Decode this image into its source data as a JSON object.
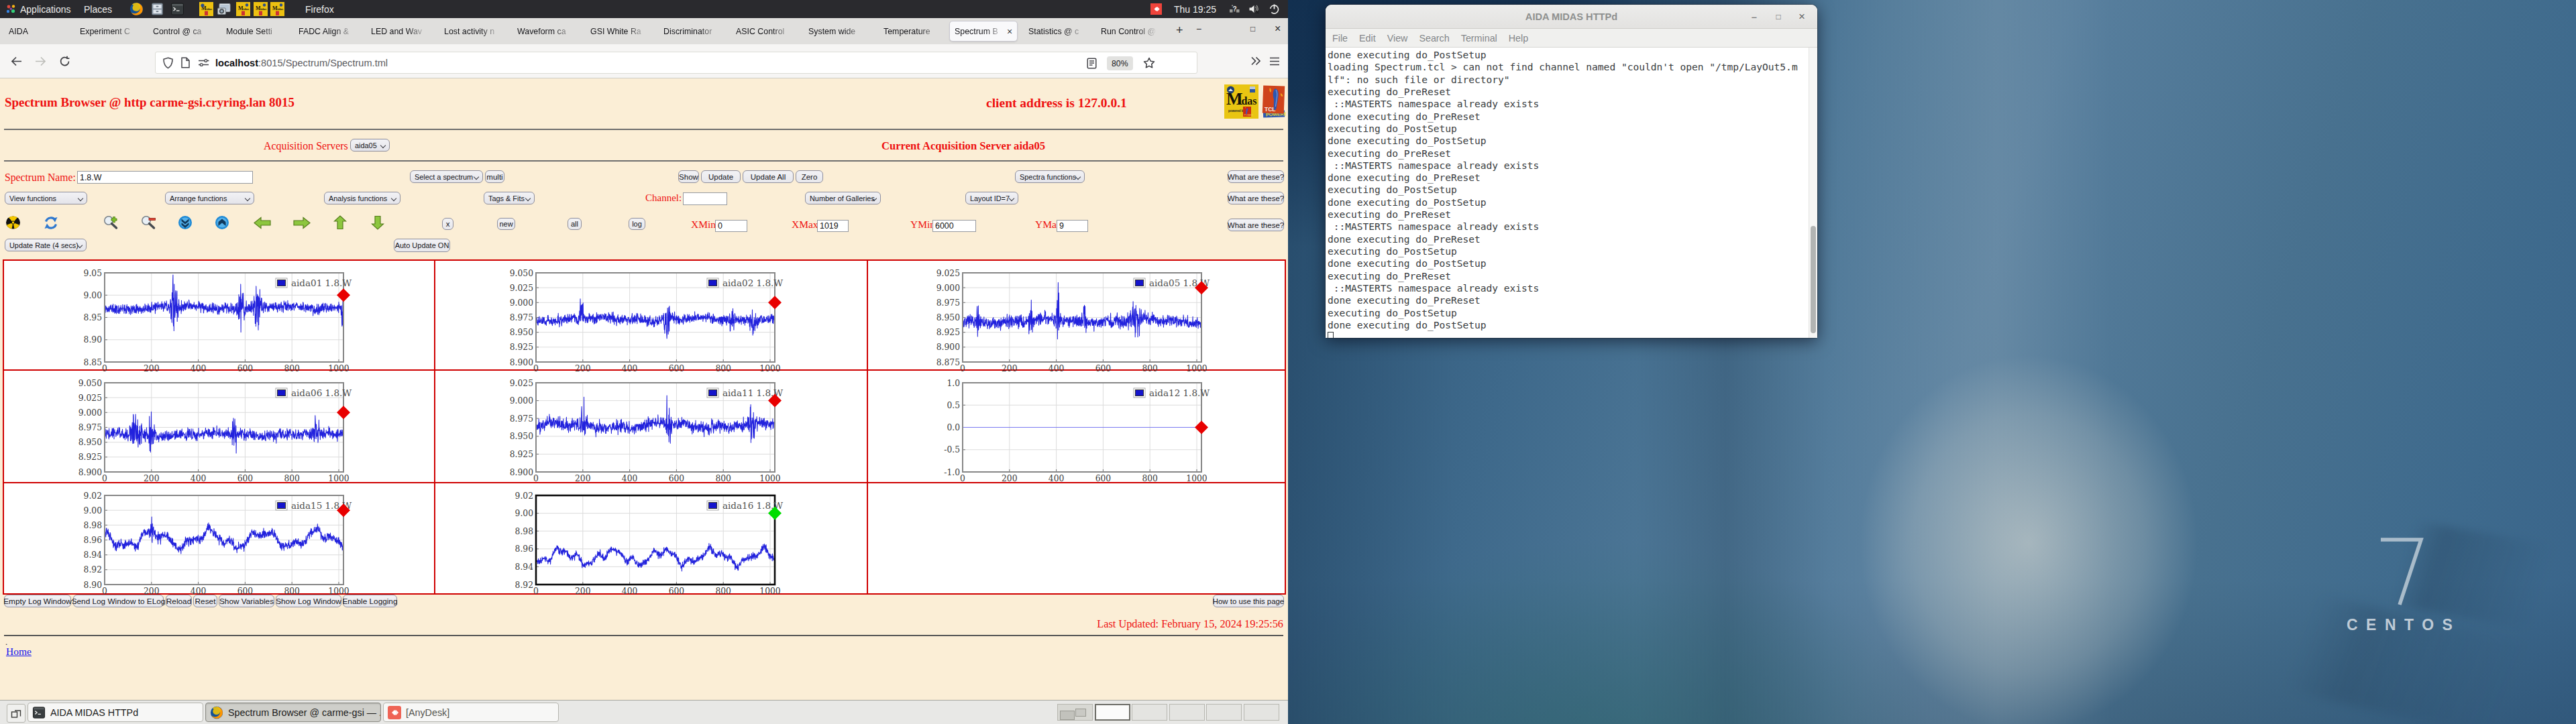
{
  "panel": {
    "applications": "Applications",
    "places": "Places",
    "active_app": "Firefox",
    "clock": "Thu 19:25",
    "launcher_icons": [
      "firefox-icon",
      "file-manager-icon",
      "terminal-icon",
      "midas-icon",
      "screenshot-icon",
      "midas-icon",
      "midas-icon",
      "midas-icon"
    ],
    "tray_icons": [
      "anydesk-icon",
      "network-question-icon",
      "volume-muted-icon",
      "power-icon"
    ]
  },
  "browser": {
    "tabs": [
      {
        "label": "AIDA"
      },
      {
        "label": "Experiment C"
      },
      {
        "label": "Control @ ca"
      },
      {
        "label": "Module Setti"
      },
      {
        "label": "FADC Align &"
      },
      {
        "label": "LED and Wav"
      },
      {
        "label": "Lost activity n"
      },
      {
        "label": "Waveform ca"
      },
      {
        "label": "GSI White Ra"
      },
      {
        "label": "Discriminator"
      },
      {
        "label": "ASIC Control"
      },
      {
        "label": "System wide"
      },
      {
        "label": "Temperature"
      },
      {
        "label": "Spectrum B",
        "active": true,
        "close": "×"
      },
      {
        "label": "Statistics @ c"
      },
      {
        "label": "Run Control @"
      }
    ],
    "new_tab": "+",
    "window_controls": {
      "minimize": "−",
      "maximize": "□",
      "close": "×"
    },
    "nav": {
      "url_host": "localhost",
      "url_rest": ":8015/Spectrum/Spectrum.tml",
      "zoom": "80%"
    }
  },
  "page": {
    "title": "Spectrum Browser @ http carme-gsi.cryring.lan 8015",
    "client": "client address is 127.0.0.1",
    "acq_label": "Acquisition Servers",
    "acq_value": "aida05",
    "acq_current": "Current Acquisition Server aida05",
    "spectrum_name_label": "Spectrum Name:",
    "spectrum_name_value": "1.8.W",
    "select_spectrum": "Select a spectrum",
    "multi": "multi",
    "show": "Show",
    "update": "Update",
    "update_all": "Update All",
    "zero": "Zero",
    "spectra_functions": "Spectra functions",
    "what1": "What are these?",
    "view_functions": "View functions",
    "arrange_functions": "Arrange functions",
    "analysis_functions": "Analysis functions",
    "tags_fits": "Tags & Fits",
    "channel_label": "Channel:",
    "channel_value": "",
    "num_galleries": "Number of Galleries",
    "layout_id": "Layout ID=7",
    "what2": "What are these?",
    "x_btn": "x",
    "new_btn": "new",
    "all_btn": "all",
    "log_btn": "log",
    "xmin_label": "XMin",
    "xmin_value": "0",
    "xmax_label": "XMax",
    "xmax_value": "1019",
    "ymin_label": "YMin",
    "ymin_value": "6000",
    "ymax_label": "YMax",
    "ymax_value": "9",
    "what3": "What are these?",
    "update_rate": "Update Rate (4 secs)",
    "auto_update": "Auto Update ON",
    "footer_buttons": [
      "Empty Log Window",
      "Send Log Window to ELog",
      "Reload",
      "Reset",
      "Show Variables",
      "Show Log Window",
      "Enable Logging"
    ],
    "howto": "How to use this page",
    "last_updated": "Last Updated: February 15, 2024 19:25:56",
    "dot": ".",
    "home": "Home"
  },
  "chart_data": [
    {
      "type": "line",
      "title": "aida01 1.8.W",
      "x": [
        0,
        1019
      ],
      "xticks": [
        0,
        200,
        400,
        600,
        800,
        1000
      ],
      "ylim": [
        8.85,
        9.05
      ],
      "yticks": [
        "8.85",
        "8.90",
        "8.95",
        "9.00",
        "9.05"
      ],
      "series": [
        {
          "name": "aida01 1.8.W",
          "color": "#2222dd",
          "signal": "noise",
          "mean": 8.972,
          "sigma": 0.0078,
          "drift": 0.003,
          "bursts": [
            [
              297,
              12,
              4.5
            ],
            [
              580,
              10,
              3.4
            ],
            [
              655,
              14,
              3.8
            ],
            [
              1013,
              5,
              3.6
            ]
          ],
          "seed": 11
        }
      ],
      "marker": {
        "x": 1019,
        "y": 9.0,
        "color": "#e80000"
      },
      "legend_pos": "top-right",
      "grid": true,
      "cell": 0
    },
    {
      "type": "line",
      "title": "aida02 1.8.W",
      "x": [
        0,
        1019
      ],
      "xticks": [
        0,
        200,
        400,
        600,
        800,
        1000
      ],
      "ylim": [
        8.9,
        9.05
      ],
      "yticks": [
        "8.900",
        "8.925",
        "8.950",
        "8.975",
        "9.000",
        "9.025",
        "9.050"
      ],
      "series": [
        {
          "name": "aida02 1.8.W",
          "color": "#2222dd",
          "signal": "noise",
          "mean": 8.972,
          "sigma": 0.006,
          "drift": 0.0024,
          "bursts": [
            [
              193,
              6,
              4.6
            ],
            [
              560,
              8,
              3.2
            ],
            [
              835,
              6,
              2.6
            ],
            [
              922,
              6,
              2.8
            ]
          ],
          "seed": 22
        }
      ],
      "marker": {
        "x": 1019,
        "y": 9.0,
        "color": "#e80000"
      },
      "legend_pos": "top-right",
      "grid": true,
      "cell": 1
    },
    {
      "type": "line",
      "title": "aida05 1.8.W",
      "x": [
        0,
        1019
      ],
      "xticks": [
        0,
        200,
        400,
        600,
        800,
        1000
      ],
      "ylim": [
        8.875,
        9.025
      ],
      "yticks": [
        "8.875",
        "8.900",
        "8.925",
        "8.950",
        "8.975",
        "9.000",
        "9.025"
      ],
      "series": [
        {
          "name": "aida05 1.8.W",
          "color": "#2222dd",
          "signal": "noise",
          "mean": 8.944,
          "sigma": 0.0073,
          "drift": 0.0028,
          "bursts": [
            [
              63,
              5,
              2.6
            ],
            [
              290,
              5,
              3.4
            ],
            [
              408,
              5,
              4.0
            ],
            [
              520,
              6,
              2.2
            ],
            [
              740,
              12,
              2.0
            ]
          ],
          "seed": 55
        }
      ],
      "marker": {
        "x": 1019,
        "y": 9.0,
        "color": "#e80000"
      },
      "legend_pos": "top-right",
      "grid": true,
      "cell": 2
    },
    {
      "type": "line",
      "title": "aida06 1.8.W",
      "x": [
        0,
        1019
      ],
      "xticks": [
        0,
        200,
        400,
        600,
        800,
        1000
      ],
      "ylim": [
        8.9,
        9.05
      ],
      "yticks": [
        "8.900",
        "8.925",
        "8.950",
        "8.975",
        "9.000",
        "9.025",
        "9.050"
      ],
      "series": [
        {
          "name": "aida06 1.8.W",
          "color": "#2222dd",
          "signal": "noise",
          "mean": 8.963,
          "sigma": 0.0065,
          "drift": 0.0024,
          "bursts": [
            [
              132,
              14,
              2.6
            ],
            [
              197,
              8,
              3.2
            ],
            [
              553,
              7,
              3.6
            ],
            [
              905,
              9,
              2.4
            ]
          ],
          "seed": 66
        }
      ],
      "marker": {
        "x": 1019,
        "y": 9.0,
        "color": "#e80000"
      },
      "legend_pos": "top-right",
      "grid": true,
      "cell": 3
    },
    {
      "type": "line",
      "title": "aida11 1.8.W",
      "x": [
        0,
        1019
      ],
      "xticks": [
        0,
        200,
        400,
        600,
        800,
        1000
      ],
      "ylim": [
        8.9,
        9.025
      ],
      "yticks": [
        "8.900",
        "8.925",
        "8.950",
        "8.975",
        "9.000",
        "9.025"
      ],
      "series": [
        {
          "name": "aida11 1.8.W",
          "color": "#2222dd",
          "signal": "noise",
          "mean": 8.965,
          "sigma": 0.0062,
          "drift": 0.003,
          "bursts": [
            [
              203,
              9,
              3.4
            ],
            [
              565,
              7,
              3.6
            ],
            [
              922,
              8,
              2.9
            ]
          ],
          "seed": 111
        }
      ],
      "marker": {
        "x": 1019,
        "y": 9.0,
        "color": "#e80000"
      },
      "legend_pos": "top-right",
      "grid": true,
      "cell": 4
    },
    {
      "type": "line",
      "title": "aida12 1.8.W",
      "x": [
        0,
        1019
      ],
      "xticks": [
        0,
        200,
        400,
        600,
        800,
        1000
      ],
      "ylim": [
        -1.0,
        1.0
      ],
      "yticks": [
        "-1.0",
        "-0.5",
        "0.0",
        "0.5",
        "1.0"
      ],
      "series": [
        {
          "name": "aida12 1.8.W",
          "color": "#7a7af0",
          "signal": "flat",
          "mean": 0.0
        }
      ],
      "marker": {
        "x": 1019,
        "y": 0.0,
        "color": "#e80000"
      },
      "legend_pos": "top-right",
      "grid": true,
      "cell": 5
    },
    {
      "type": "line",
      "title": "aida15 1.8.W",
      "x": [
        0,
        1019
      ],
      "xticks": [
        0,
        200,
        400,
        600,
        800,
        1000
      ],
      "ylim": [
        8.9,
        9.02
      ],
      "yticks": [
        "8.90",
        "8.92",
        "8.94",
        "8.96",
        "8.98",
        "9.00",
        "9.02"
      ],
      "series": [
        {
          "name": "aida15 1.8.W",
          "color": "#2222dd",
          "signal": "wavy",
          "mean": 8.961,
          "sigma": 0.0044,
          "wave": [
            0.009,
            235,
            0.0042,
            89
          ],
          "bursts": [
            [
              200,
              5,
              3.2
            ]
          ],
          "seed": 155
        }
      ],
      "marker": {
        "x": 1019,
        "y": 9.0,
        "color": "#e80000"
      },
      "legend_pos": "top-right",
      "grid": true,
      "cell": 6
    },
    {
      "type": "line",
      "title": "aida16 1.8.W",
      "x": [
        0,
        1019
      ],
      "xticks": [
        0,
        200,
        400,
        600,
        800,
        1000
      ],
      "ylim": [
        8.92,
        9.02
      ],
      "yticks": [
        "8.92",
        "8.94",
        "8.96",
        "8.98",
        "9.00",
        "9.02"
      ],
      "series": [
        {
          "name": "aida16 1.8.W",
          "color": "#2222dd",
          "signal": "wavy",
          "mean": 8.951,
          "sigma": 0.0028,
          "wave": [
            0.0068,
            215,
            0.003,
            80
          ],
          "bursts": [],
          "seed": 166
        }
      ],
      "marker": {
        "x": 1019,
        "y": 9.0,
        "color": "#00dd00"
      },
      "legend_pos": "top-right",
      "grid": true,
      "selected": true,
      "cell": 7
    }
  ],
  "taskbar": {
    "windows": [
      {
        "label": "AIDA MIDAS HTTPd",
        "icon": "terminal-icon",
        "active": false
      },
      {
        "label": "Spectrum Browser @ carme-gsi — ...",
        "icon": "firefox-icon",
        "active": true
      },
      {
        "label": "[AnyDesk]",
        "icon": "anydesk-icon",
        "active": false
      }
    ],
    "workspaces": 6,
    "active_workspace": 1
  },
  "terminal": {
    "title": "AIDA MIDAS HTTPd",
    "buttons": {
      "minimize": "−",
      "maximize": "□",
      "close": "×"
    },
    "menu": [
      "File",
      "Edit",
      "View",
      "Search",
      "Terminal",
      "Help"
    ],
    "lines": [
      "done executing do_PostSetup",
      "loading Spectrum.tcl > can not find channel named \"couldn't open \"/tmp/LayOut5.m",
      "lf\": no such file or directory\"",
      "executing do_PreReset",
      " ::MASTERTS namespace already exists",
      "done executing do_PreReset",
      "executing do_PostSetup",
      "done executing do_PostSetup",
      "executing do_PreReset",
      " ::MASTERTS namespace already exists",
      "done executing do_PreReset",
      "executing do_PostSetup",
      "done executing do_PostSetup",
      "executing do_PreReset",
      " ::MASTERTS namespace already exists",
      "done executing do_PreReset",
      "executing do_PostSetup",
      "done executing do_PostSetup",
      "executing do_PreReset",
      " ::MASTERTS namespace already exists",
      "done executing do_PreReset",
      "executing do_PostSetup",
      "done executing do_PostSetup"
    ]
  },
  "desktop": {
    "seven": "7",
    "centos": "CENTOS"
  }
}
